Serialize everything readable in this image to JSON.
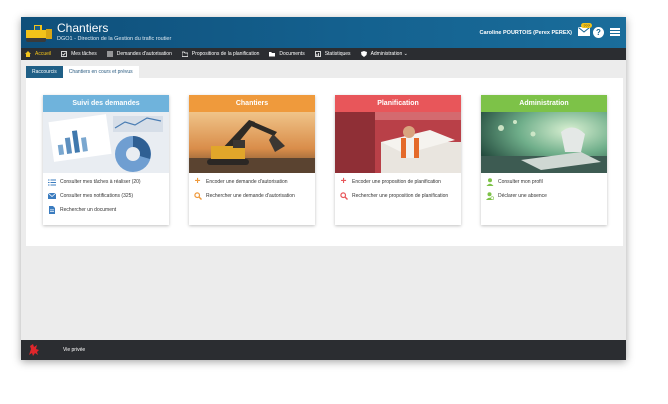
{
  "header": {
    "title": "Chantiers",
    "subtitle": "DGO1 - Direction de la Gestion du trafic routier",
    "user": "Caroline POURTOIS (Perex PEREX)",
    "mail_count": "???",
    "help_label": "?"
  },
  "nav": {
    "items": [
      {
        "label": "Accueil",
        "icon": "home-icon"
      },
      {
        "label": "Mes tâches",
        "icon": "checklist-icon"
      },
      {
        "label": "Demandes d'autorisation",
        "icon": "list-icon"
      },
      {
        "label": "Propositions de la planification",
        "icon": "folder-icon"
      },
      {
        "label": "Documents",
        "icon": "folder-icon"
      },
      {
        "label": "Statistiques",
        "icon": "chart-icon"
      },
      {
        "label": "Administration ⌄",
        "icon": "shield-icon"
      }
    ]
  },
  "tabs": [
    "Raccourcis",
    "Chantiers en cours et prévus"
  ],
  "cards": [
    {
      "title": "Suivi des demandes",
      "color": "#6fb3dc",
      "links": [
        {
          "label": "Consulter mes tâches à réaliser (20)",
          "icon": "list-icon"
        },
        {
          "label": "Consulter mes notifications (325)",
          "icon": "envelope-icon"
        },
        {
          "label": "Rechercher un document",
          "icon": "document-icon"
        }
      ]
    },
    {
      "title": "Chantiers",
      "color": "#ef9a3c",
      "links": [
        {
          "label": "Encoder une demande d'autorisation",
          "icon": "plus-icon"
        },
        {
          "label": "Rechercher une demande d'autorisation",
          "icon": "search-icon"
        }
      ]
    },
    {
      "title": "Planification",
      "color": "#e8565a",
      "links": [
        {
          "label": "Encoder une proposition de planification",
          "icon": "plus-icon"
        },
        {
          "label": "Rechercher une proposition de planification",
          "icon": "search-icon"
        }
      ]
    },
    {
      "title": "Administration",
      "color": "#7dc248",
      "links": [
        {
          "label": "Consulter mon profil",
          "icon": "user-icon"
        },
        {
          "label": "Déclarer une absence",
          "icon": "user-clock-icon"
        }
      ]
    }
  ],
  "footer": {
    "privacy": "Vie privée"
  }
}
